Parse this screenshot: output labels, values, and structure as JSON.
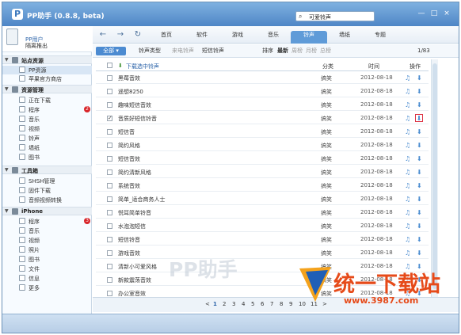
{
  "app": {
    "title": "PP助手 (0.8.8, beta)",
    "logo_letter": "P"
  },
  "search": {
    "text": "可爱铃声"
  },
  "window_controls": {
    "min": "—",
    "max": "□",
    "close": "×"
  },
  "user": {
    "name": "PP用户",
    "logout": "隔离推出"
  },
  "sidebar": {
    "group1": "站点资源",
    "group1_items": [
      "PP资源",
      "苹果官方商店"
    ],
    "group2": "资源管理",
    "group2_items": [
      "正在下载",
      "程序",
      "音乐",
      "视频",
      "铃声",
      "墙纸",
      "图书"
    ],
    "group2_badge": "2",
    "group3": "工具箱",
    "group3_items": [
      "SHSH管理",
      "固件下载",
      "音频视频转换"
    ],
    "group4": "iPhone",
    "group4_items": [
      "程序",
      "音乐",
      "视频",
      "照片",
      "图书",
      "文件",
      "信息",
      "更多"
    ],
    "group4_badge": "3"
  },
  "toolbar": {
    "back": "←",
    "forward": "→",
    "refresh": "↻",
    "tabs": [
      "首页",
      "软件",
      "游戏",
      "音乐",
      "铃声",
      "墙纸",
      "专题"
    ],
    "active_tab": "铃声"
  },
  "filter": {
    "all": "全部",
    "types": [
      "铃声类型",
      "来电铃声",
      "短信铃声"
    ],
    "sort": "排序",
    "sort_opts": [
      "最新",
      "周榜",
      "月榜",
      "总榜"
    ],
    "page": "1/83"
  },
  "table": {
    "download_selected": "下载选中铃声",
    "col_category": "分类",
    "col_time": "时间",
    "col_action": "操作",
    "rows": [
      {
        "name": "黑莓音效",
        "cat": "搞笑",
        "time": "2012-08-18"
      },
      {
        "name": "遥想8250",
        "cat": "搞笑",
        "time": "2012-08-18"
      },
      {
        "name": "趣味短信音效",
        "cat": "搞笑",
        "time": "2012-08-18"
      },
      {
        "name": "音质好短信铃音",
        "cat": "搞笑",
        "time": "2012-08-18",
        "checked": true
      },
      {
        "name": "短信音",
        "cat": "搞笑",
        "time": "2012-08-18"
      },
      {
        "name": "简约风格",
        "cat": "搞笑",
        "time": "2012-08-18"
      },
      {
        "name": "短信音效",
        "cat": "搞笑",
        "time": "2012-08-18"
      },
      {
        "name": "简约清新风格",
        "cat": "搞笑",
        "time": "2012-08-18"
      },
      {
        "name": "系统音效",
        "cat": "搞笑",
        "time": "2012-08-18"
      },
      {
        "name": "简单_适合商务人士",
        "cat": "搞笑",
        "time": "2012-08-18"
      },
      {
        "name": "悦耳简单铃音",
        "cat": "搞笑",
        "time": "2012-08-18"
      },
      {
        "name": "水泡泡短信",
        "cat": "搞笑",
        "time": "2012-08-18"
      },
      {
        "name": "短信铃音",
        "cat": "搞笑",
        "time": "2012-08-18"
      },
      {
        "name": "游戏音效",
        "cat": "搞笑",
        "time": "2012-08-18"
      },
      {
        "name": "清新小可爱风格",
        "cat": "搞笑",
        "time": "2012-08-18"
      },
      {
        "name": "新款震荡音效",
        "cat": "搞笑",
        "time": "2012-08-18"
      },
      {
        "name": "办公室音效",
        "cat": "搞笑",
        "time": "2012-08-18"
      }
    ]
  },
  "pagination": {
    "prev": "<",
    "pages": [
      "1",
      "2",
      "3",
      "4",
      "5",
      "6",
      "7",
      "8",
      "9",
      "10",
      "11"
    ],
    "next": ">"
  },
  "watermark": "PP助手",
  "brand": {
    "name": "统一下载站",
    "url": "www.3987.com"
  },
  "colors": {
    "accent": "#4c8bd1",
    "titlebar": "#5f9bd8",
    "badge": "#d9262b"
  }
}
